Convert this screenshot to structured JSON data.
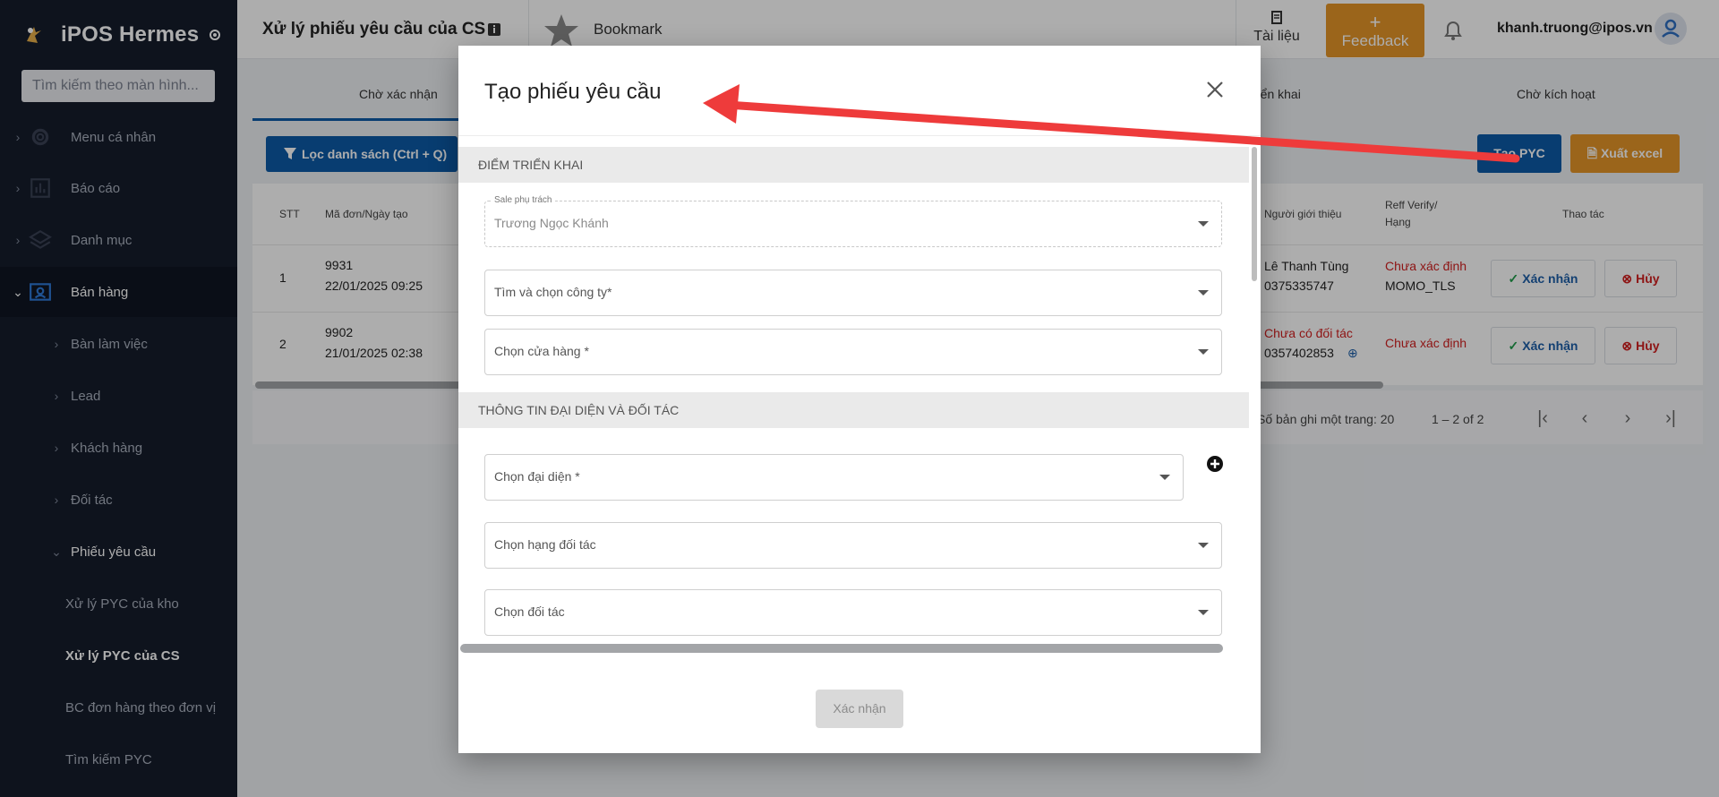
{
  "sidebar": {
    "app_name": "iPOS Hermes",
    "search_placeholder": "Tìm kiếm theo màn hình...",
    "items": [
      {
        "label": "Menu cá nhân",
        "icon": "gear-icon"
      },
      {
        "label": "Báo cáo",
        "icon": "chart-icon"
      },
      {
        "label": "Danh mục",
        "icon": "layers-icon"
      },
      {
        "label": "Bán hàng",
        "icon": "contact-card-icon"
      }
    ],
    "sub_items": [
      "Bàn làm việc",
      "Lead",
      "Khách hàng",
      "Đối tác",
      "Phiếu yêu cầu"
    ],
    "sub2_items": [
      "Xử lý PYC của kho",
      "Xử lý PYC của CS",
      "BC đơn hàng theo đơn vị",
      "Tìm kiếm PYC"
    ]
  },
  "topbar": {
    "title": "Xử lý phiếu yêu cầu của CS",
    "bookmark": "Bookmark",
    "docs": "Tài liệu",
    "feedback": "Feedback",
    "user": "khanh.truong@ipos.vn"
  },
  "tabs": [
    "Chờ xác nhận",
    "triển khai",
    "Chờ kích hoạt"
  ],
  "toolbar": {
    "filter": "Lọc danh sách (Ctrl + Q)",
    "create": "Tạo PYC",
    "excel": "Xuất excel"
  },
  "table": {
    "headers": [
      "STT",
      "Mã đơn/Ngày tạo",
      "Người giới thiệu",
      "Reff Verify/ Hạng",
      "Thao tác"
    ],
    "rows": [
      {
        "stt": "1",
        "code": "9931",
        "date": "22/01/2025 09:25",
        "ref_name": "Lê Thanh Tùng",
        "ref_phone": "0375335747",
        "verify": "Chưa xác định",
        "rank": "MOMO_TLS"
      },
      {
        "stt": "2",
        "code": "9902",
        "date": "21/01/2025 02:38",
        "ref_name": "Chưa có đối tác",
        "ref_phone": "0357402853",
        "verify": "Chưa xác định",
        "rank": ""
      }
    ],
    "confirm": "Xác nhận",
    "cancel": "Hủy"
  },
  "pager": {
    "page_size": "Số bản ghi một trang: 20",
    "range": "1 – 2 of 2"
  },
  "modal": {
    "title": "Tạo phiếu yêu cầu",
    "section1": "ĐIỂM TRIỂN KHAI",
    "sale_label": "Sale phụ trách",
    "sale_value": "Trương Ngọc Khánh",
    "company": "Tìm và chọn công ty*",
    "store": "Chọn cửa hàng *",
    "section2": "THÔNG TIN ĐẠI DIỆN VÀ ĐỐI TÁC",
    "rep": "Chọn đại diện *",
    "partner_rank": "Chọn hạng đối tác",
    "partner": "Chọn đối tác",
    "submit": "Xác nhận"
  },
  "colors": {
    "primary": "#0d5aa7",
    "orange": "#e59528",
    "sidebar": "#151c2c",
    "danger": "#d21f1f",
    "arrow": "#ee3b3b"
  }
}
